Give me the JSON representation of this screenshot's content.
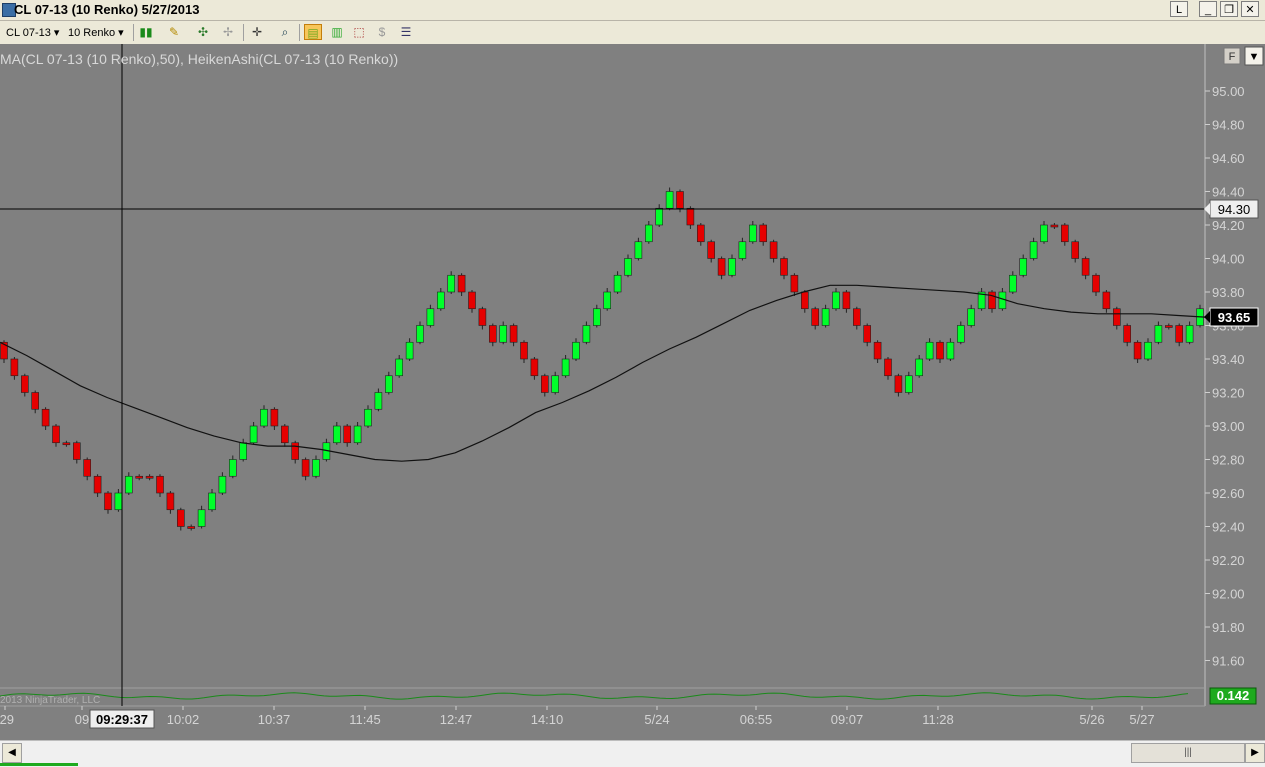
{
  "window": {
    "title": "CL 07-13 (10 Renko)  5/27/2013",
    "buttons": [
      "L",
      "_",
      "❐",
      "✕"
    ]
  },
  "toolbar": {
    "instrument": "CL 07-13",
    "period": "10 Renko"
  },
  "chart": {
    "indicator_label": "MA(CL 07-13 (10 Renko),50), HeikenAshi(CL 07-13 (10 Renko))",
    "copyright": "2013 NinjaTrader, LLC",
    "f_button": "F",
    "crosshair_price": "94.30",
    "current_price": "93.65",
    "sub_panel_value": "0.142",
    "crosshair_time": "09:29:37",
    "colors": {
      "up": "#00ff2a",
      "down": "#e60000",
      "background": "#808080",
      "ma": "#111111"
    }
  },
  "chart_data": {
    "type": "candlestick",
    "x_tick_labels": [
      ":29",
      "09",
      "10:02",
      "10:37",
      "11:45",
      "12:47",
      "14:10",
      "5/24",
      "06:55",
      "09:07",
      "11:28",
      "5/26",
      "5/27"
    ],
    "y_tick_labels": [
      "95.00",
      "94.80",
      "94.60",
      "94.40",
      "94.20",
      "94.00",
      "93.80",
      "93.60",
      "93.40",
      "93.20",
      "93.00",
      "92.80",
      "92.60",
      "92.40",
      "92.20",
      "92.00",
      "91.80",
      "91.60"
    ],
    "ylim": [
      91.5,
      95.2
    ],
    "ma_period": 50,
    "open": 93.5,
    "closes": [
      93.4,
      93.3,
      93.2,
      93.1,
      93.0,
      92.9,
      92.9,
      92.8,
      92.7,
      92.6,
      92.5,
      92.6,
      92.7,
      92.7,
      92.7,
      92.6,
      92.5,
      92.4,
      92.4,
      92.5,
      92.6,
      92.7,
      92.8,
      92.9,
      93.0,
      93.1,
      93.0,
      92.9,
      92.8,
      92.7,
      92.8,
      92.9,
      93.0,
      92.9,
      93.0,
      93.1,
      93.2,
      93.3,
      93.4,
      93.5,
      93.6,
      93.7,
      93.8,
      93.9,
      93.8,
      93.7,
      93.6,
      93.5,
      93.6,
      93.5,
      93.4,
      93.3,
      93.2,
      93.3,
      93.4,
      93.5,
      93.6,
      93.7,
      93.8,
      93.9,
      94.0,
      94.1,
      94.2,
      94.3,
      94.4,
      94.3,
      94.2,
      94.1,
      94.0,
      93.9,
      94.0,
      94.1,
      94.2,
      94.1,
      94.0,
      93.9,
      93.8,
      93.7,
      93.6,
      93.7,
      93.8,
      93.7,
      93.6,
      93.5,
      93.4,
      93.3,
      93.2,
      93.3,
      93.4,
      93.5,
      93.4,
      93.5,
      93.6,
      93.7,
      93.8,
      93.7,
      93.8,
      93.9,
      94.0,
      94.1,
      94.2,
      94.2,
      94.1,
      94.0,
      93.9,
      93.8,
      93.7,
      93.6,
      93.5,
      93.4,
      93.5,
      93.6,
      93.6,
      93.5,
      93.6,
      93.7
    ],
    "ma_values": [
      93.5,
      93.42,
      93.33,
      93.24,
      93.17,
      93.11,
      93.05,
      92.99,
      92.94,
      92.9,
      92.88,
      92.88,
      92.86,
      92.83,
      92.8,
      92.79,
      92.8,
      92.84,
      92.91,
      92.99,
      93.08,
      93.14,
      93.21,
      93.29,
      93.38,
      93.46,
      93.53,
      93.61,
      93.69,
      93.75,
      93.8,
      93.84,
      93.84,
      93.83,
      93.82,
      93.81,
      93.8,
      93.78,
      93.73,
      93.7,
      93.68,
      93.67,
      93.67,
      93.67,
      93.66,
      93.65
    ]
  }
}
